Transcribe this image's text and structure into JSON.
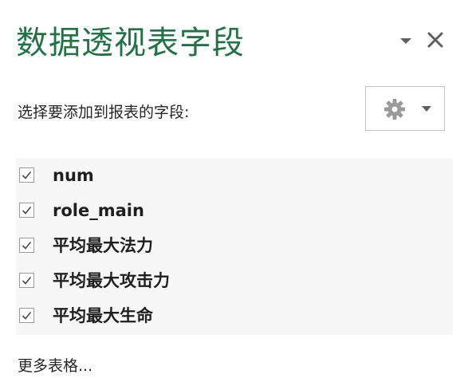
{
  "pane": {
    "title": "数据透视表字段",
    "subtitle": "选择要添加到报表的字段:",
    "menu_icon": "chevron-down-icon",
    "close_icon": "close-icon",
    "tools_icon": "gear-icon"
  },
  "fields": [
    {
      "label": "num",
      "checked": true
    },
    {
      "label": "role_main",
      "checked": true
    },
    {
      "label": "平均最大法力",
      "checked": true
    },
    {
      "label": "平均最大攻击力",
      "checked": true
    },
    {
      "label": "平均最大生命",
      "checked": true
    }
  ],
  "more_tables": "更多表格...",
  "colors": {
    "title": "#217346",
    "list_background": "#f7f7f7",
    "icon": "#5f5f5f"
  }
}
